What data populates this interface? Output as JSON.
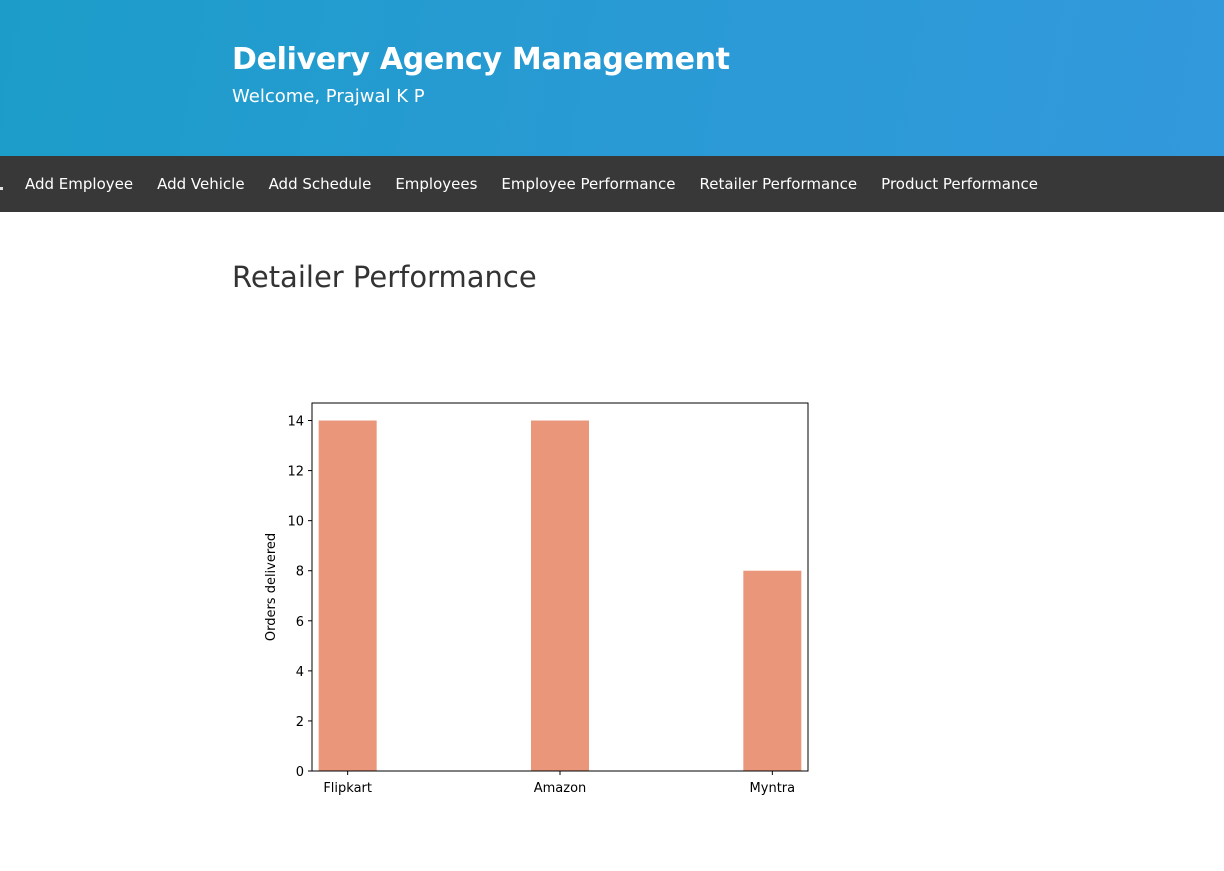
{
  "header": {
    "title": "Delivery Agency Management",
    "welcome": "Welcome, Prajwal K P"
  },
  "nav": {
    "items": [
      {
        "label": "Add Employee"
      },
      {
        "label": "Add Vehicle"
      },
      {
        "label": "Add Schedule"
      },
      {
        "label": "Employees"
      },
      {
        "label": "Employee Performance"
      },
      {
        "label": "Retailer Performance"
      },
      {
        "label": "Product Performance"
      }
    ]
  },
  "main": {
    "title": "Retailer Performance"
  },
  "colors": {
    "header_gradient_start": "#1c9dc9",
    "header_gradient_end": "#3299dc",
    "nav_background": "#383838",
    "bar": "#e9967a"
  },
  "chart_data": {
    "type": "bar",
    "categories": [
      "Flipkart",
      "Amazon",
      "Myntra"
    ],
    "values": [
      14,
      14,
      8
    ],
    "title": "",
    "xlabel": "",
    "ylabel": "Orders delivered",
    "ylim": [
      0,
      14.7
    ],
    "yticks": [
      0,
      2,
      4,
      6,
      8,
      10,
      12,
      14
    ],
    "grid": false
  }
}
